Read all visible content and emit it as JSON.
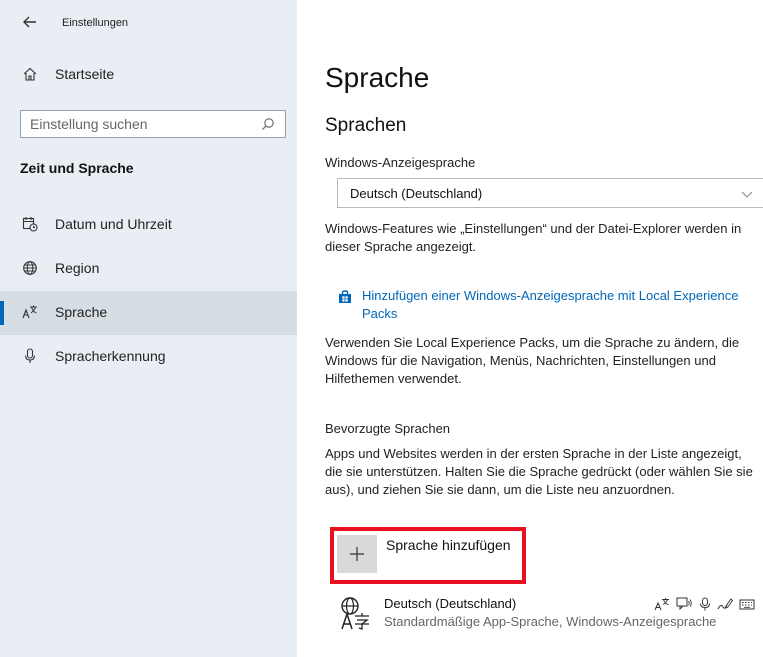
{
  "window": {
    "title": "Einstellungen",
    "back_icon": "back-arrow-icon"
  },
  "sidebar": {
    "home_label": "Startseite",
    "search_placeholder": "Einstellung suchen",
    "section_label": "Zeit und Sprache",
    "items": [
      {
        "label": "Datum und Uhrzeit",
        "icon": "calendar-clock-icon",
        "selected": false
      },
      {
        "label": "Region",
        "icon": "globe-icon",
        "selected": false
      },
      {
        "label": "Sprache",
        "icon": "language-icon",
        "selected": true
      },
      {
        "label": "Spracherkennung",
        "icon": "microphone-icon",
        "selected": false
      }
    ]
  },
  "main": {
    "title": "Sprache",
    "section_heading": "Sprachen",
    "display_language_label": "Windows-Anzeigesprache",
    "display_language_value": "Deutsch (Deutschland)",
    "display_language_desc": "Windows-Features wie „Einstellungen“ und der Datei-Explorer werden in dieser Sprache angezeigt.",
    "lxp_link": "Hinzufügen einer Windows-Anzeigesprache mit Local Experience Packs",
    "lxp_desc": "Verwenden Sie Local Experience Packs, um die Sprache zu ändern, die Windows für die Navigation, Menüs, Nachrichten, Einstellungen und Hilfethemen verwendet.",
    "preferred_label": "Bevorzugte Sprachen",
    "preferred_desc": "Apps und Websites werden in der ersten Sprache in der Liste angezeigt, die sie unterstützen. Halten Sie die Sprache gedrückt (oder wählen Sie sie aus), und ziehen Sie sie dann, um die Liste neu anzuordnen.",
    "add_language_label": "Sprache hinzufügen",
    "language_entry": {
      "name": "Deutsch (Deutschland)",
      "subtitle": "Standardmäßige App-Sprache, Windows-Anzeigesprache"
    }
  },
  "colors": {
    "accent": "#0067b8",
    "highlight_border": "#e81123",
    "sidebar_bg": "#e8eef3"
  }
}
